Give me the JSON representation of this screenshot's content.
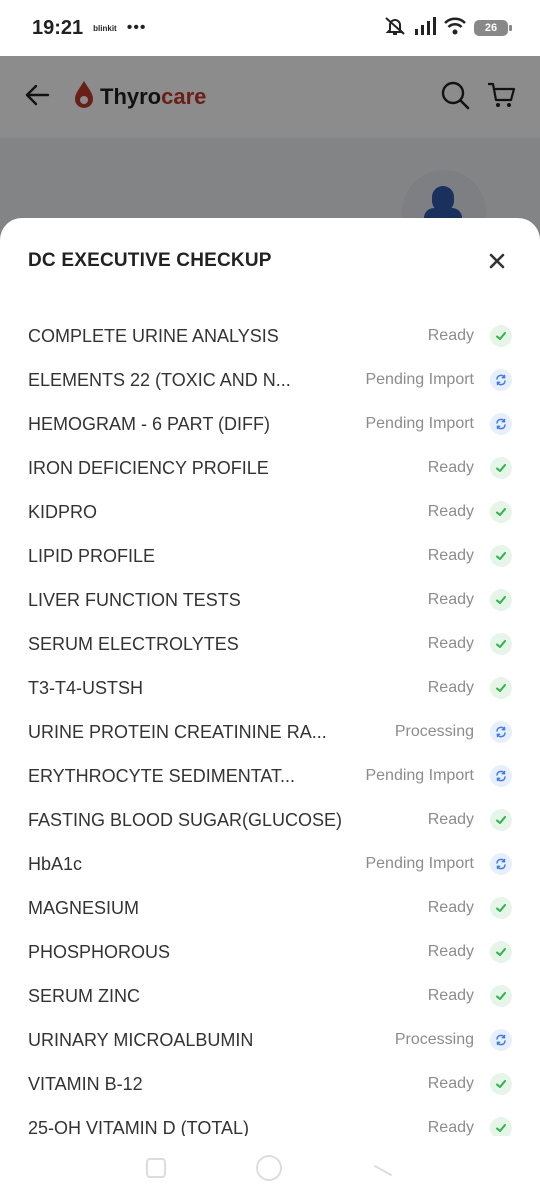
{
  "status_bar": {
    "time": "19:21",
    "app_label": "blinkit",
    "more": "•••",
    "battery": "26"
  },
  "header": {
    "logo_main": "Thyro",
    "logo_accent": "care",
    "icons": [
      "back-arrow-icon",
      "search-icon",
      "cart-icon"
    ]
  },
  "sheet": {
    "title": "DC EXECUTIVE CHECKUP",
    "close_icon": "close-icon",
    "tests": [
      {
        "name": "COMPLETE URINE ANALYSIS",
        "status": "Ready",
        "state": "ready"
      },
      {
        "name": "ELEMENTS 22 (TOXIC AND N...",
        "status": "Pending Import",
        "state": "pending"
      },
      {
        "name": "HEMOGRAM - 6 PART (DIFF)",
        "status": "Pending Import",
        "state": "pending"
      },
      {
        "name": "IRON DEFICIENCY PROFILE",
        "status": "Ready",
        "state": "ready"
      },
      {
        "name": "KIDPRO",
        "status": "Ready",
        "state": "ready"
      },
      {
        "name": "LIPID PROFILE",
        "status": "Ready",
        "state": "ready"
      },
      {
        "name": "LIVER FUNCTION TESTS",
        "status": "Ready",
        "state": "ready"
      },
      {
        "name": "SERUM ELECTROLYTES",
        "status": "Ready",
        "state": "ready"
      },
      {
        "name": "T3-T4-USTSH",
        "status": "Ready",
        "state": "ready"
      },
      {
        "name": "URINE PROTEIN CREATININE RA...",
        "status": "Processing",
        "state": "pending"
      },
      {
        "name": "ERYTHROCYTE SEDIMENTAT...",
        "status": "Pending Import",
        "state": "pending"
      },
      {
        "name": "FASTING BLOOD SUGAR(GLUCOSE)",
        "status": "Ready",
        "state": "ready"
      },
      {
        "name": "HbA1c",
        "status": "Pending Import",
        "state": "pending"
      },
      {
        "name": "MAGNESIUM",
        "status": "Ready",
        "state": "ready"
      },
      {
        "name": "PHOSPHOROUS",
        "status": "Ready",
        "state": "ready"
      },
      {
        "name": "SERUM ZINC",
        "status": "Ready",
        "state": "ready"
      },
      {
        "name": "URINARY MICROALBUMIN",
        "status": "Processing",
        "state": "pending"
      },
      {
        "name": "VITAMIN B-12",
        "status": "Ready",
        "state": "ready"
      },
      {
        "name": "25-OH VITAMIN D (TOTAL)",
        "status": "Ready",
        "state": "ready"
      }
    ]
  },
  "colors": {
    "ready_icon": "#2eb24a",
    "ready_bg": "#e5f6e9",
    "pending_icon": "#3d7be8",
    "pending_bg": "#e7effc",
    "brand_red": "#c0392b"
  }
}
